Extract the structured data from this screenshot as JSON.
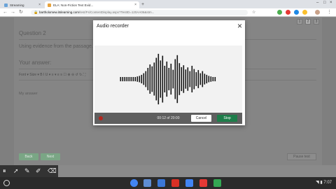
{
  "browser": {
    "tabs": [
      {
        "label": "Streaming",
        "active": false
      },
      {
        "label": "ELA: Non-Fiction Text Evid...",
        "active": true
      }
    ],
    "url_host": "bartholomew.itslearning.com",
    "url_path": "/test/Fs/ContentDisplay.aspx?TestID=120AA06&stm..."
  },
  "page": {
    "question_title": "Question 2",
    "question_text": "Using evidence from the passage...",
    "answer_label": "Your answer:",
    "editor_toolbar": "Font  ▾   Size  ▾    B  I  U  ▾   ≡  ▾   ≡  ≡   ☐  ⊕  ⊖   ↺  ↻   ⛶",
    "answer_placeholder": "My answer",
    "page_numbers": [
      "1",
      "2",
      "3"
    ],
    "back_label": "Back",
    "next_label": "Next",
    "pause_label": "Pause test"
  },
  "recorder": {
    "title": "Audio recorder",
    "timer": "00:12 of 20:00",
    "cancel_label": "Cancel",
    "stop_label": "Stop",
    "waveform": [
      0.08,
      0.08,
      0.08,
      0.08,
      0.08,
      0.08,
      0.08,
      0.08,
      0.1,
      0.12,
      0.16,
      0.22,
      0.3,
      0.42,
      0.55,
      0.48,
      0.62,
      0.8,
      0.95,
      0.7,
      0.88,
      0.5,
      0.66,
      0.42,
      0.58,
      0.35,
      0.75,
      0.9,
      0.6,
      0.45,
      0.52,
      0.36,
      0.44,
      0.3,
      0.5,
      0.38,
      0.26,
      0.34,
      0.22,
      0.3,
      0.2,
      0.16,
      0.12,
      0.1,
      0.08,
      0.08
    ]
  },
  "shelf": {
    "time": "7:07",
    "apps": [
      {
        "name": "chrome-icon",
        "color": "#4285f4"
      },
      {
        "name": "camera-icon",
        "color": "#5f8dd3"
      },
      {
        "name": "files-icon",
        "color": "#3c78d8"
      },
      {
        "name": "gmail-icon",
        "color": "#d93025"
      },
      {
        "name": "docs-icon",
        "color": "#4285f4"
      },
      {
        "name": "youtube-icon",
        "color": "#e53935"
      },
      {
        "name": "play-icon",
        "color": "#34a853"
      }
    ]
  }
}
